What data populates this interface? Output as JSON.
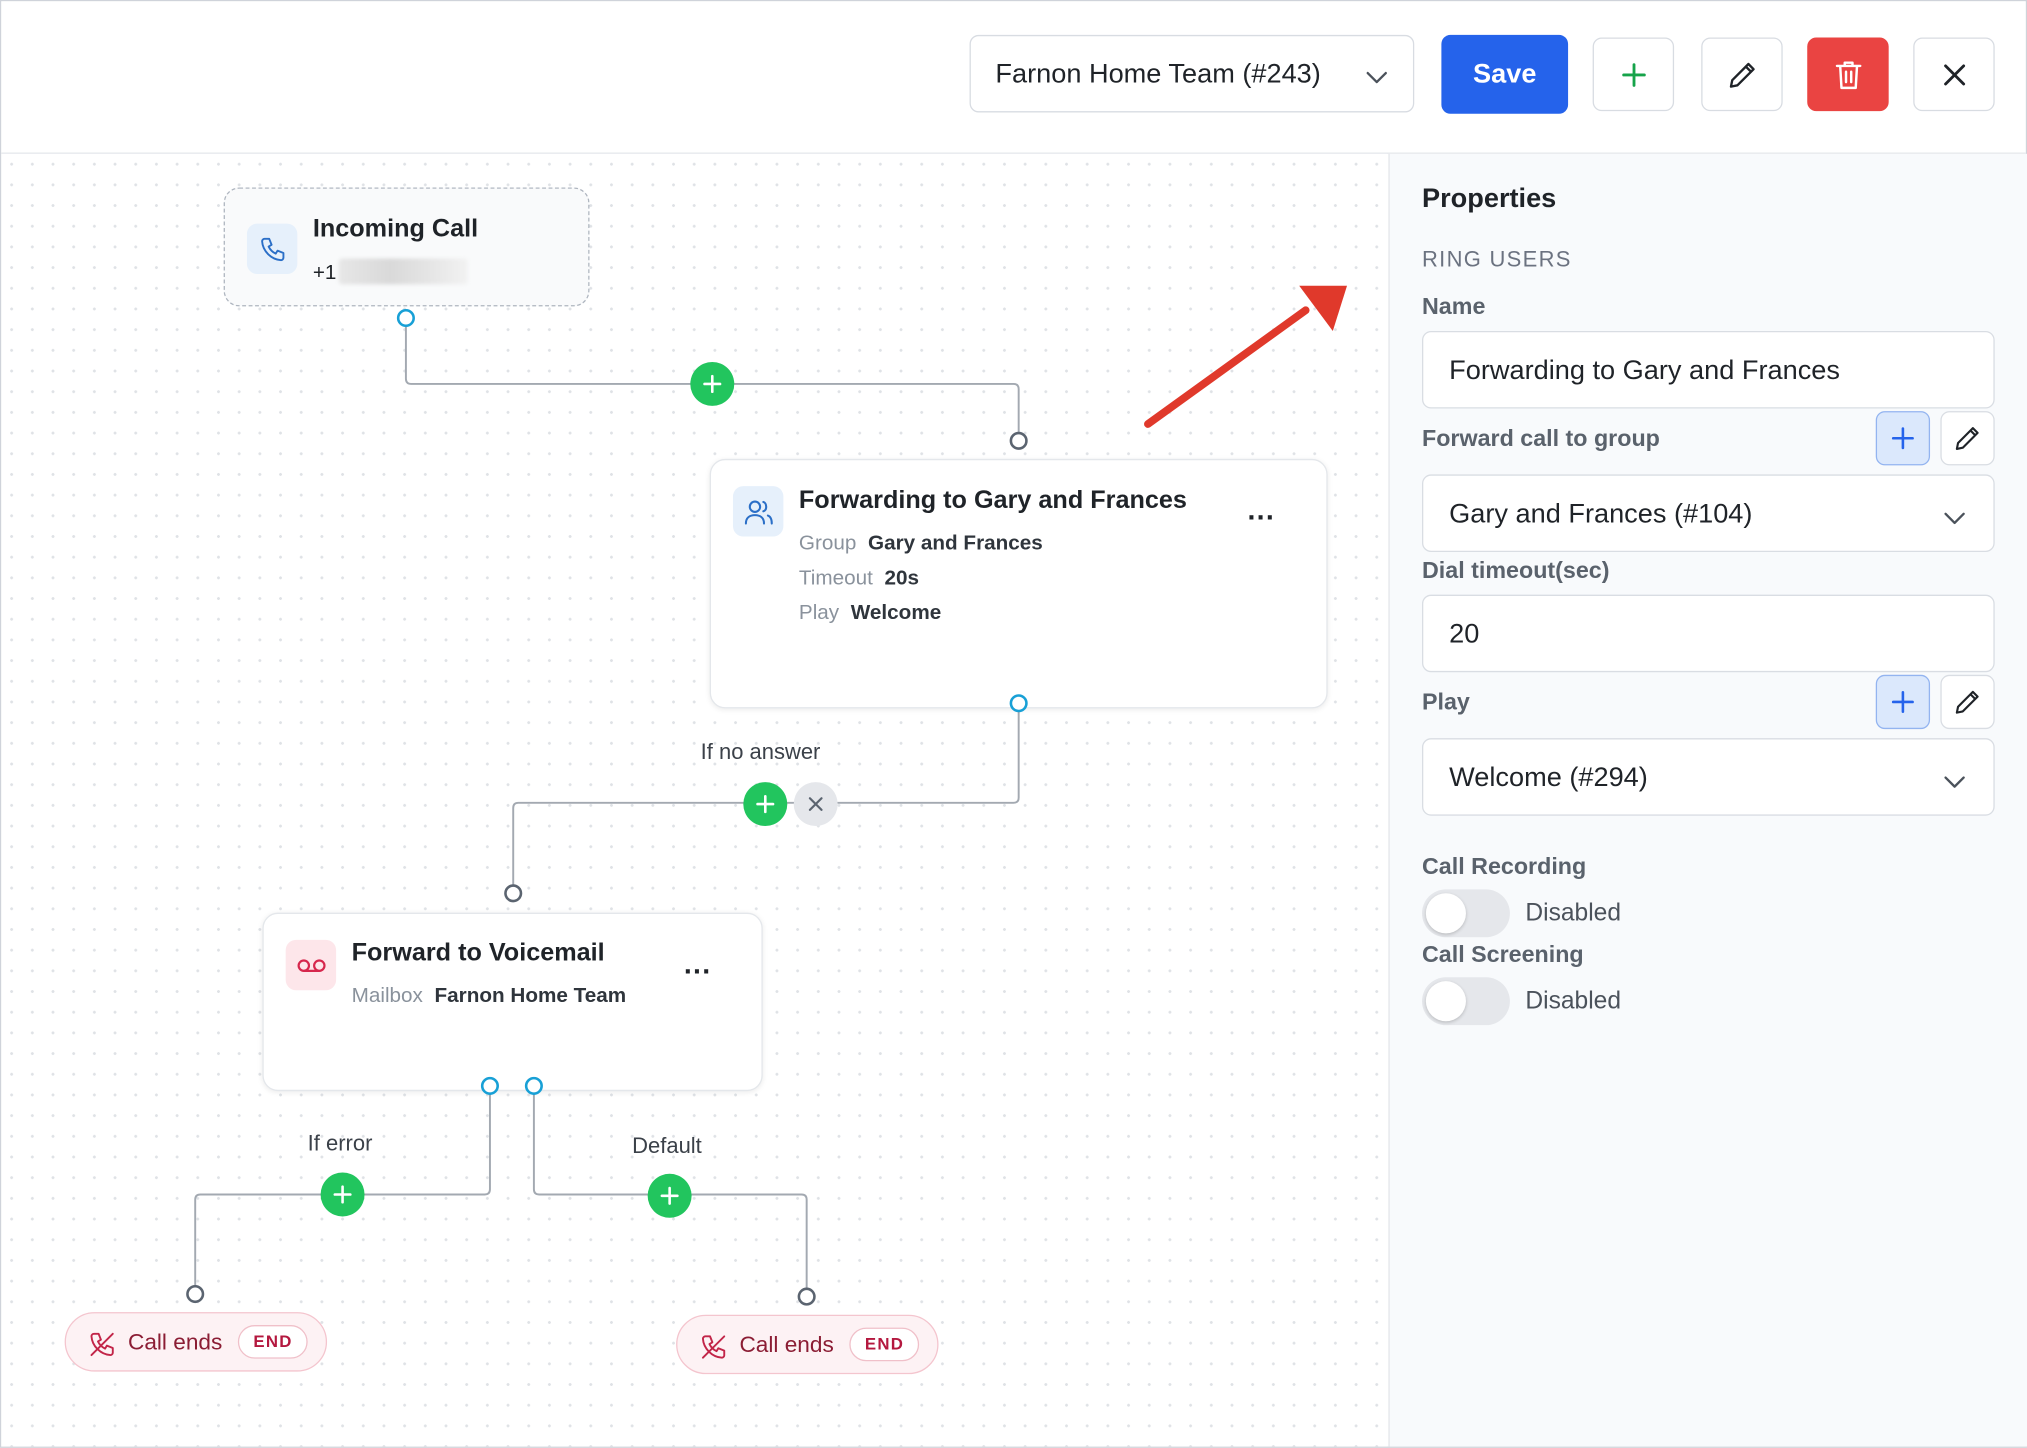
{
  "toolbar": {
    "team_select": "Farnon Home Team (#243)",
    "save_label": "Save"
  },
  "flow": {
    "incoming": {
      "title": "Incoming Call",
      "number_prefix": "+1"
    },
    "forward": {
      "title": "Forwarding to Gary and Frances",
      "group_key": "Group",
      "group_val": "Gary and Frances",
      "timeout_key": "Timeout",
      "timeout_val": "20s",
      "play_key": "Play",
      "play_val": "Welcome",
      "menu": "..."
    },
    "no_answer_label": "If no answer",
    "voicemail": {
      "title": "Forward to Voicemail",
      "mailbox_key": "Mailbox",
      "mailbox_val": "Farnon Home Team",
      "menu": "..."
    },
    "error_label": "If error",
    "default_label": "Default",
    "end_left": {
      "label": "Call ends",
      "tag": "END"
    },
    "end_right": {
      "label": "Call ends",
      "tag": "END"
    }
  },
  "properties": {
    "title": "Properties",
    "section": "RING USERS",
    "name_label": "Name",
    "name_value": "Forwarding to Gary and Frances",
    "group_label": "Forward call to group",
    "group_value": "Gary and Frances (#104)",
    "timeout_label": "Dial timeout(sec)",
    "timeout_value": "20",
    "play_label": "Play",
    "play_value": "Welcome (#294)",
    "recording_label": "Call Recording",
    "recording_state": "Disabled",
    "screening_label": "Call Screening",
    "screening_state": "Disabled"
  },
  "colors": {
    "primary": "#2563eb",
    "danger": "#ea4442",
    "success": "#22c55e",
    "handle": "#18a0d6",
    "annotation_arrow": "#e0392b"
  },
  "icons": [
    "chevron-down-icon",
    "plus-icon",
    "pencil-icon",
    "trash-icon",
    "close-icon",
    "phone-icon",
    "users-icon",
    "voicemail-icon",
    "call-end-icon"
  ]
}
